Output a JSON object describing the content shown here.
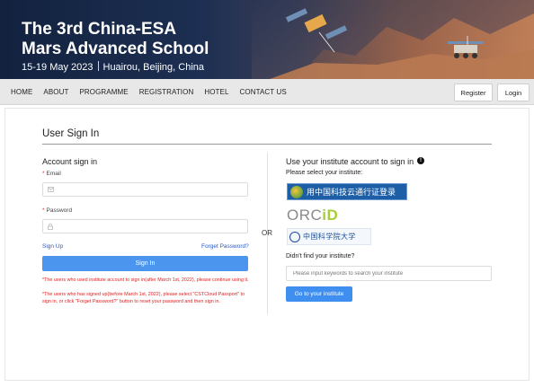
{
  "banner": {
    "title_line1": "The 3rd China-ESA",
    "title_line2": "Mars Advanced School",
    "dates": "15-19 May 2023",
    "location": "Huairou, Beijing, China"
  },
  "nav": {
    "items": [
      "HOME",
      "ABOUT",
      "PROGRAMME",
      "REGISTRATION",
      "HOTEL",
      "CONTACT US"
    ],
    "register_label": "Register",
    "login_label": "Login"
  },
  "page": {
    "title": "User Sign In"
  },
  "account": {
    "heading": "Account sign in",
    "email_label": "Email",
    "password_label": "Password",
    "required_mark": "*",
    "signup_link": "Sign Up",
    "forgot_link": "Forget Password?",
    "signin_button": "Sign In",
    "note1": "*The users who used institute account to sign in(after March 1st, 2022), please continue using it.",
    "note2": "*The users who has signed up(before March 1st, 2022), please select \"CSTCloud Passport\" to sign in, or click \"Forget Password?\" button to reset your password and then sign in."
  },
  "divider": {
    "or_label": "OR"
  },
  "institute": {
    "heading": "Use your institute account to sign in",
    "select_label": "Please select your institute:",
    "cstc_label": "用中国科技云通行证登录",
    "orcid_text_a": "ORC",
    "orcid_text_b": "iD",
    "cas_label": "中国科学院大学",
    "not_found_label": "Didn't find your institute?",
    "search_placeholder": "Please input keywords to search your institute",
    "go_button": "Go to your institute"
  },
  "colors": {
    "accent_blue": "#4b95ee",
    "error_red": "#e02020",
    "nav_bg": "#e8e8e8",
    "orcid_green": "#a6ce39"
  }
}
